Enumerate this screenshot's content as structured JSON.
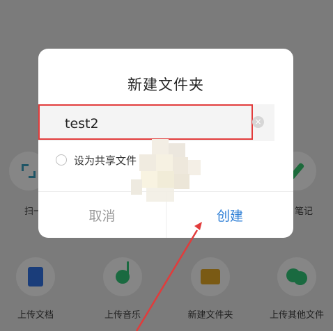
{
  "background_actions": {
    "row1": [
      {
        "label": "扫一",
        "icon": "scan-icon"
      },
      {
        "label": "笔记",
        "icon": "pen-icon"
      }
    ],
    "row2": [
      {
        "label": "上传文档",
        "icon": "document-icon"
      },
      {
        "label": "上传音乐",
        "icon": "music-icon"
      },
      {
        "label": "新建文件夹",
        "icon": "folder-icon"
      },
      {
        "label": "上传其他文件",
        "icon": "other-file-icon"
      }
    ]
  },
  "dialog": {
    "title": "新建文件夹",
    "input_value": "test2",
    "clear_icon": "×",
    "share_option_label": "设为共享文件",
    "cancel_label": "取消",
    "create_label": "创建"
  },
  "colors": {
    "accent_blue": "#2f7fd6",
    "highlight_red": "#e23b3b",
    "overlay_gray": "#7b7b7b"
  }
}
